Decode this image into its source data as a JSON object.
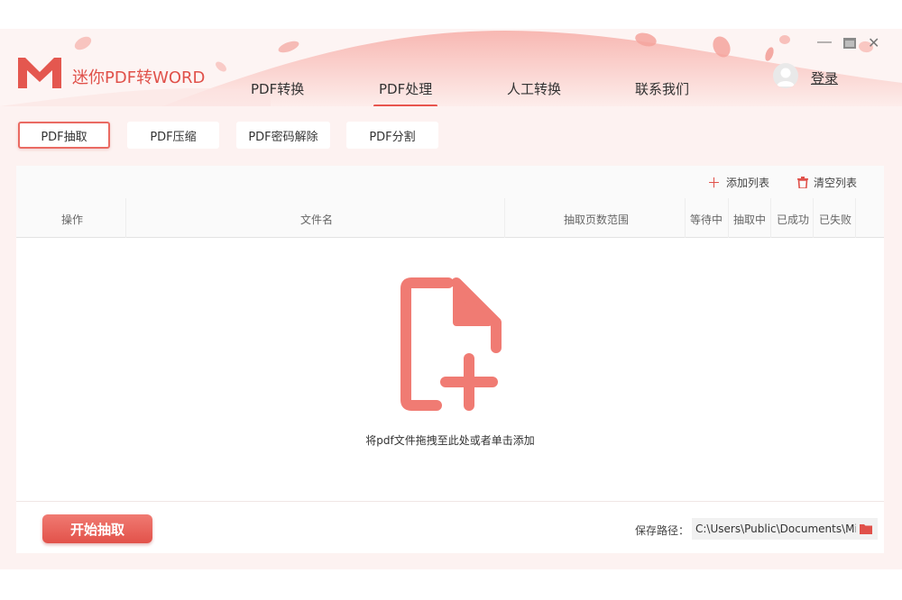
{
  "app": {
    "title": "迷你PDF转WORD"
  },
  "nav": {
    "tabs": [
      {
        "label": "PDF转换"
      },
      {
        "label": "PDF处理",
        "active": true
      },
      {
        "label": "人工转换"
      },
      {
        "label": "联系我们"
      }
    ]
  },
  "window_controls": {
    "minimize": "—",
    "close": "✕"
  },
  "user": {
    "login_label": "登录"
  },
  "subtabs": [
    {
      "label": "PDF抽取",
      "active": true
    },
    {
      "label": "PDF压缩"
    },
    {
      "label": "PDF密码解除"
    },
    {
      "label": "PDF分割"
    }
  ],
  "toolbar": {
    "add_label": "添加列表",
    "clear_label": "清空列表"
  },
  "table": {
    "columns": [
      "操作",
      "文件名",
      "抽取页数范围",
      "等待中",
      "抽取中",
      "已成功",
      "已失败"
    ]
  },
  "dropzone": {
    "hint": "将pdf文件拖拽至此处或者单击添加"
  },
  "footer": {
    "start_label": "开始抽取",
    "save_path_label": "保存路径：",
    "save_path_value": "C:\\Users\\Public\\Documents\\Mini"
  },
  "colors": {
    "accent": "#e8554e",
    "file_icon": "#f07b73",
    "folder_icon": "#e0514a"
  },
  "icons": {
    "add": "plus-icon",
    "clear": "trash-icon",
    "file": "file-add-icon",
    "folder": "folder-icon",
    "avatar": "user-avatar-icon"
  }
}
